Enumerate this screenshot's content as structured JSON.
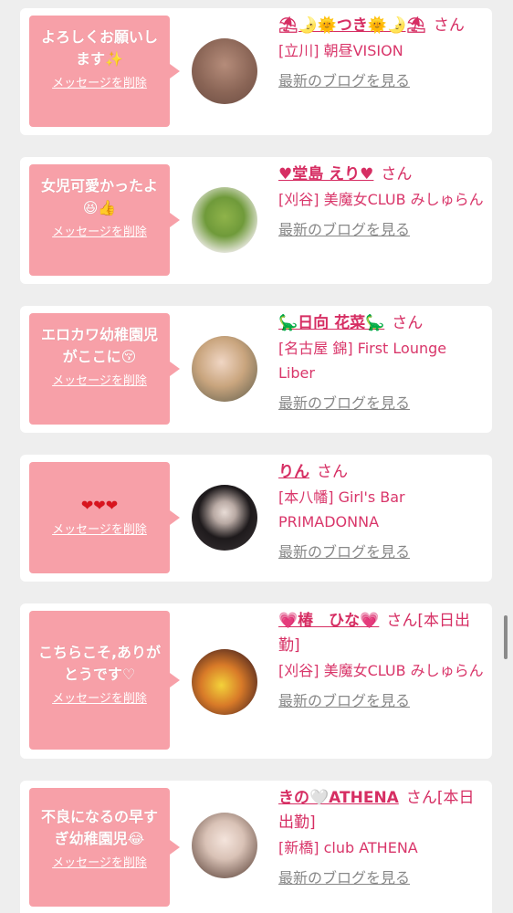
{
  "delete_label": "メッセージを削除",
  "blog_label": "最新のブログを見る",
  "colors": {
    "bubble": "#f7a0a8",
    "name": "#d62e63",
    "card": "#ffffff",
    "background": "#eeeeee"
  },
  "cards": [
    {
      "message_l1": "よろしくお願いし",
      "message_l2": "ます✨",
      "name": "⛱🌛🌞つき🌞🌛⛱",
      "suffix": "さん",
      "shop": "[立川] 朝昼VISION"
    },
    {
      "message_l1": "女児可愛かったよ",
      "message_l2": "😆👍",
      "name": "♥堂島 えり♥",
      "suffix": "さん",
      "shop": "[刈谷] 美魔女CLUB みしゅらん"
    },
    {
      "message_l1": "エロカワ幼稚園児",
      "message_l2": "がここに😚",
      "name": "🦕日向 花菜🦕",
      "suffix": "さん",
      "shop": "[名古屋 錦] First Lounge Liber"
    },
    {
      "message_l1": "❤❤❤",
      "message_l2": "",
      "name": "りん",
      "suffix": "さん",
      "shop": "[本八幡] Girl's Bar PRIMADONNA"
    },
    {
      "message_l1": "こちらこそ,ありが",
      "message_l2": "とうです♡",
      "name": "💗椿　ひな💗",
      "suffix": "さん[本日出勤]",
      "shop": "[刈谷] 美魔女CLUB みしゅらん"
    },
    {
      "message_l1": "不良になるの早す",
      "message_l2": "ぎ幼稚園児😂",
      "name": "きの🤍ATHENA",
      "suffix": "さん[本日出勤]",
      "shop": "[新橋] club ATHENA"
    }
  ]
}
